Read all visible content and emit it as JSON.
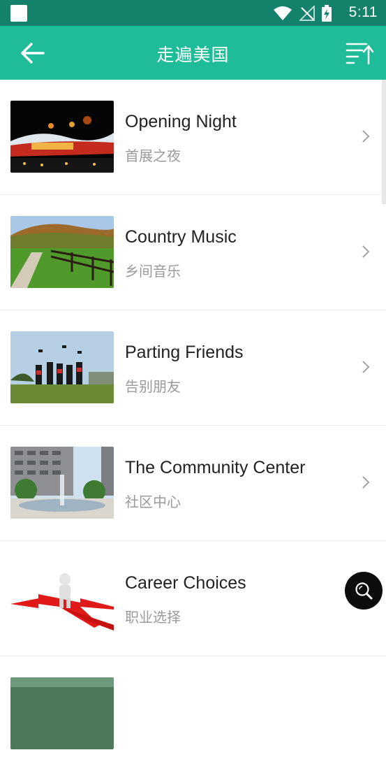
{
  "status_bar": {
    "time": "5:11"
  },
  "app_bar": {
    "title": "走遍美国"
  },
  "items": [
    {
      "title": "Opening Night",
      "subtitle": "首展之夜"
    },
    {
      "title": "Country Music",
      "subtitle": "乡间音乐"
    },
    {
      "title": "Parting Friends",
      "subtitle": "告别朋友"
    },
    {
      "title": "The Community Center",
      "subtitle": "社区中心"
    },
    {
      "title": "Career Choices",
      "subtitle": "职业选择"
    },
    {
      "title": "",
      "subtitle": ""
    }
  ],
  "colors": {
    "status_bar": "#14826a",
    "app_bar": "#1ebc98",
    "fab": "#0d0d0d"
  }
}
